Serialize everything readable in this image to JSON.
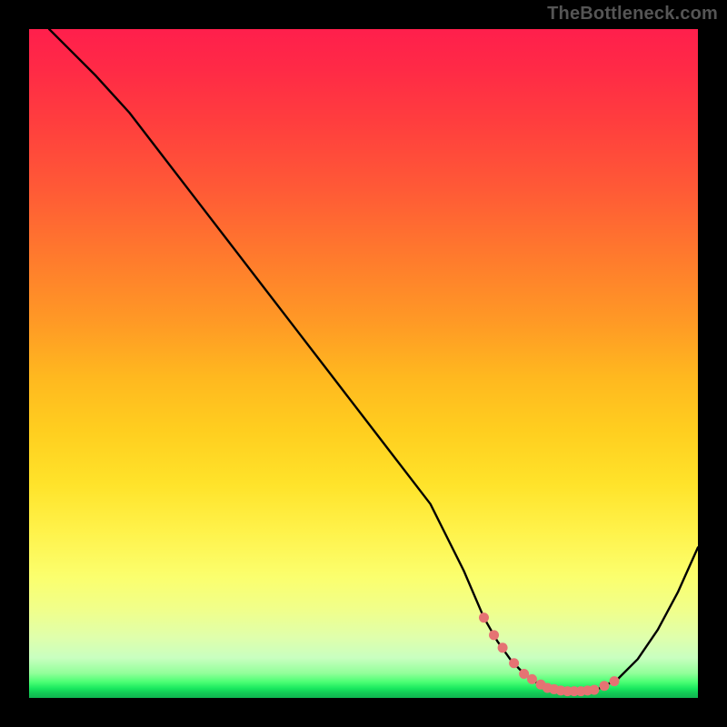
{
  "watermark": "TheBottleneck.com",
  "chart_data": {
    "type": "line",
    "title": "",
    "xlabel": "",
    "ylabel": "",
    "xlim": [
      0,
      100
    ],
    "ylim": [
      0,
      100
    ],
    "grid": false,
    "legend": false,
    "series": [
      {
        "name": "bottleneck-curve",
        "color": "#000000",
        "x": [
          3,
          6,
          10,
          15,
          20,
          25,
          30,
          35,
          40,
          45,
          50,
          55,
          60,
          62,
          65,
          68,
          70,
          72,
          74,
          76,
          78,
          80,
          82,
          85,
          88,
          91,
          94,
          97,
          100
        ],
        "y": [
          100,
          97,
          93,
          87.5,
          81,
          74.5,
          68,
          61.5,
          55,
          48.5,
          42,
          35.5,
          29,
          25,
          19,
          12,
          8.5,
          5.7,
          3.6,
          2.2,
          1.3,
          1.0,
          1.0,
          1.3,
          2.8,
          5.8,
          10.2,
          15.8,
          22.5
        ]
      }
    ],
    "markers": {
      "name": "optimal-range",
      "color": "#e57373",
      "x": [
        68,
        69.5,
        70.8,
        72.5,
        74,
        75.2,
        76.5,
        77.5,
        78.5,
        79.5,
        80.5,
        81.5,
        82.5,
        83.5,
        84.5,
        86,
        87.5
      ],
      "y": [
        12,
        9.4,
        7.5,
        5.2,
        3.6,
        2.8,
        2.0,
        1.5,
        1.3,
        1.1,
        1.0,
        1.0,
        1.0,
        1.1,
        1.2,
        1.8,
        2.5
      ]
    },
    "background": {
      "type": "vertical-gradient",
      "stops": [
        {
          "pos": 0.0,
          "color": "#ff1f4c"
        },
        {
          "pos": 0.5,
          "color": "#ffb81f"
        },
        {
          "pos": 0.8,
          "color": "#fbff6e"
        },
        {
          "pos": 0.965,
          "color": "#92ff9a"
        },
        {
          "pos": 1.0,
          "color": "#10b550"
        }
      ]
    }
  }
}
